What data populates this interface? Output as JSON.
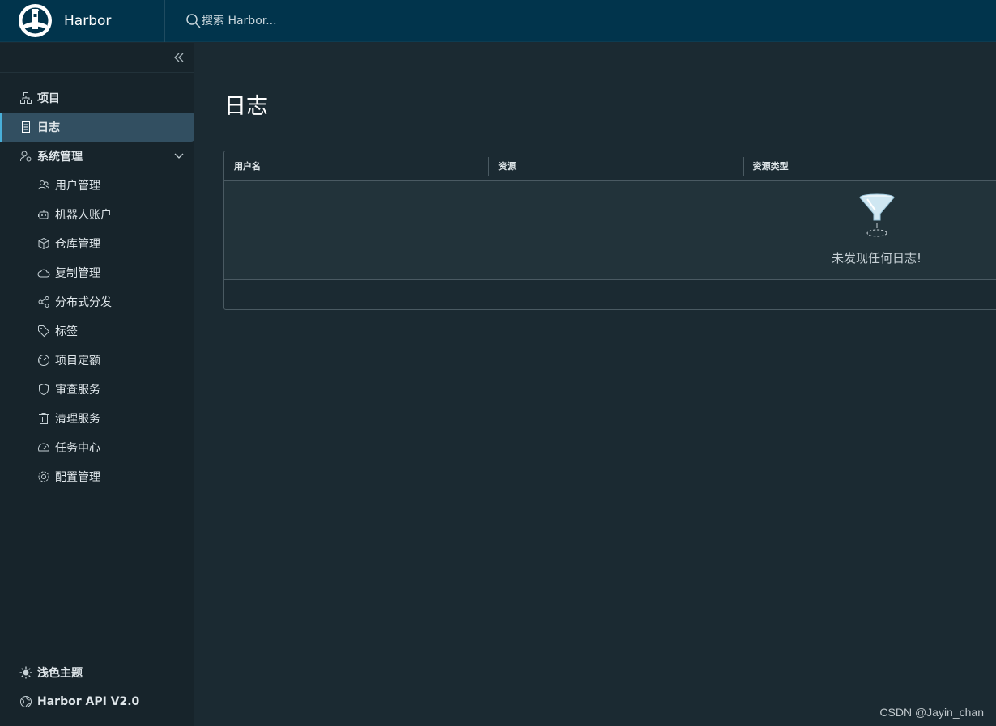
{
  "header": {
    "brand_name": "Harbor",
    "search_placeholder": "搜索 Harbor...",
    "background": "#01344c"
  },
  "sidebar": {
    "items": [
      {
        "label": "项目",
        "icon": "project-icon"
      },
      {
        "label": "日志",
        "icon": "log-icon",
        "active": true
      },
      {
        "label": "系统管理",
        "icon": "admin-icon"
      }
    ],
    "sub_items": [
      {
        "label": "用户管理",
        "icon": "users-icon"
      },
      {
        "label": "机器人账户",
        "icon": "robot-icon"
      },
      {
        "label": "仓库管理",
        "icon": "box-icon"
      },
      {
        "label": "复制管理",
        "icon": "cloud-icon"
      },
      {
        "label": "分布式分发",
        "icon": "share-icon"
      },
      {
        "label": "标签",
        "icon": "tag-icon"
      },
      {
        "label": "项目定额",
        "icon": "gauge-icon"
      },
      {
        "label": "审查服务",
        "icon": "shield-icon"
      },
      {
        "label": "清理服务",
        "icon": "trash-icon"
      },
      {
        "label": "任务中心",
        "icon": "dashboard-icon"
      },
      {
        "label": "配置管理",
        "icon": "gear-icon"
      }
    ],
    "footer": {
      "theme_label": "浅色主题",
      "api_label": "Harbor API V2.0"
    }
  },
  "main": {
    "title": "日志",
    "columns": [
      "用户名",
      "资源",
      "资源类型"
    ],
    "empty_text": "未发现任何日志!"
  },
  "watermark": "CSDN @Jayin_chan",
  "colors": {
    "accent": "#49afd9",
    "active_bg": "#324f61"
  }
}
